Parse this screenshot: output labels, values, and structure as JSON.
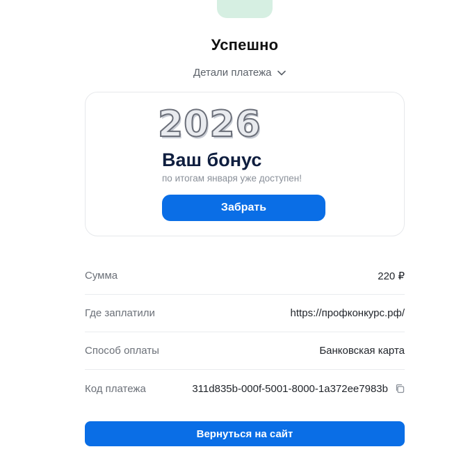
{
  "header": {
    "status_title": "Успешно",
    "details_toggle_label": "Детали платежа"
  },
  "promo": {
    "year": "2026",
    "heading": "Ваш бонус",
    "subtitle": "по итогам января уже доступен!",
    "button_label": "Забрать"
  },
  "details": {
    "rows": [
      {
        "label": "Сумма",
        "value": "220 ₽"
      },
      {
        "label": "Где заплатили",
        "value": "https://профконкурс.рф/"
      },
      {
        "label": "Способ оплаты",
        "value": "Банковская карта"
      },
      {
        "label": "Код платежа",
        "value": "311d835b-000f-5001-8000-1a372ee7983b"
      }
    ]
  },
  "footer": {
    "return_button_label": "Вернуться на сайт"
  },
  "icons": {
    "status": "success-check-icon",
    "toggle": "chevron-down-icon",
    "copy": "copy-icon"
  },
  "colors": {
    "accent": "#0a6ee6",
    "success": "#1f9d6b",
    "success_bg": "#d6efe2"
  }
}
